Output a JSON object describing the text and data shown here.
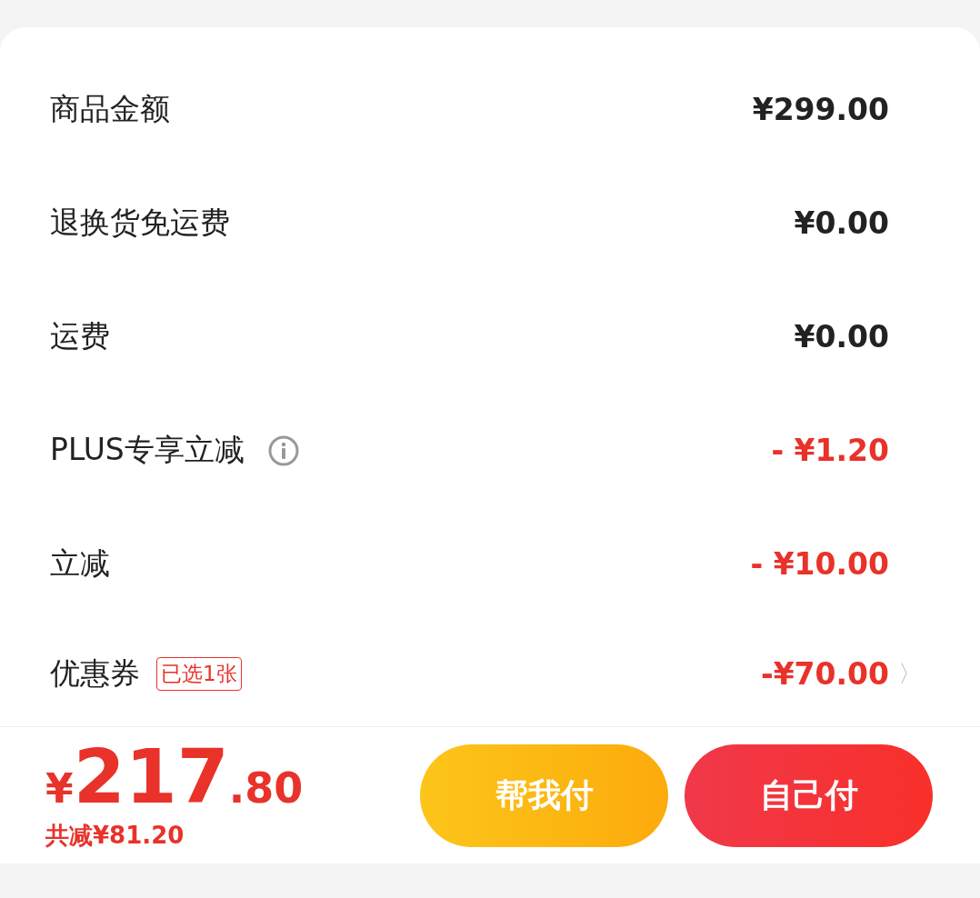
{
  "rows": [
    {
      "kind": "plain",
      "label": "商品金额",
      "value": "¥299.00"
    },
    {
      "kind": "plain",
      "label": "退换货免运费",
      "value": "¥0.00"
    },
    {
      "kind": "plain",
      "label": "运费",
      "value": "¥0.00"
    },
    {
      "kind": "discount",
      "label": "PLUS专享立减",
      "value": "- ¥1.20",
      "info": true
    },
    {
      "kind": "discount",
      "label": "立减",
      "value": "- ¥10.00"
    },
    {
      "kind": "discount",
      "label": "优惠券",
      "value": "-¥70.00",
      "badge": "已选1张",
      "chevron": "〉"
    }
  ],
  "footer": {
    "currency": "¥",
    "integer": "217",
    "decimal": ".80",
    "savings": "共减¥81.20",
    "buttons": [
      {
        "kind": "secondary",
        "label": "帮我付"
      },
      {
        "kind": "primary",
        "label": "自己付"
      }
    ]
  }
}
